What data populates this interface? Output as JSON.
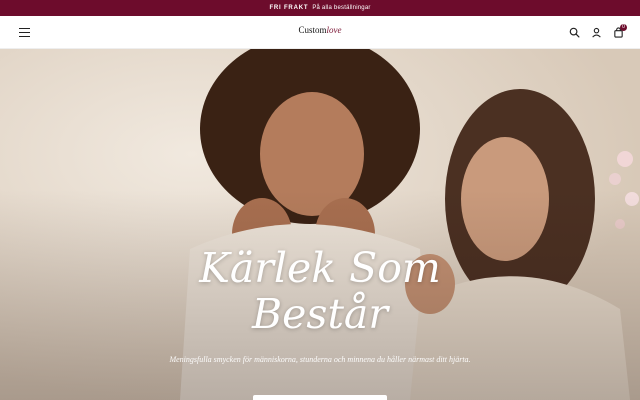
{
  "announcement": {
    "highlight": "FRI FRAKT",
    "text": "På alla beställningar",
    "background": "#6d0c2c"
  },
  "header": {
    "logo_part1": "Custom",
    "logo_part2": "love",
    "cart_count": "0",
    "icons": [
      "menu-icon",
      "search-icon",
      "user-icon",
      "bag-icon"
    ]
  },
  "hero": {
    "title_line1": "Kärlek Som",
    "title_line2": "Består",
    "subtitle": "Meningsfulla smycken för människorna, stunderna och minnena du håller närmast ditt hjärta."
  },
  "colors": {
    "brand": "#6d0c2c"
  }
}
